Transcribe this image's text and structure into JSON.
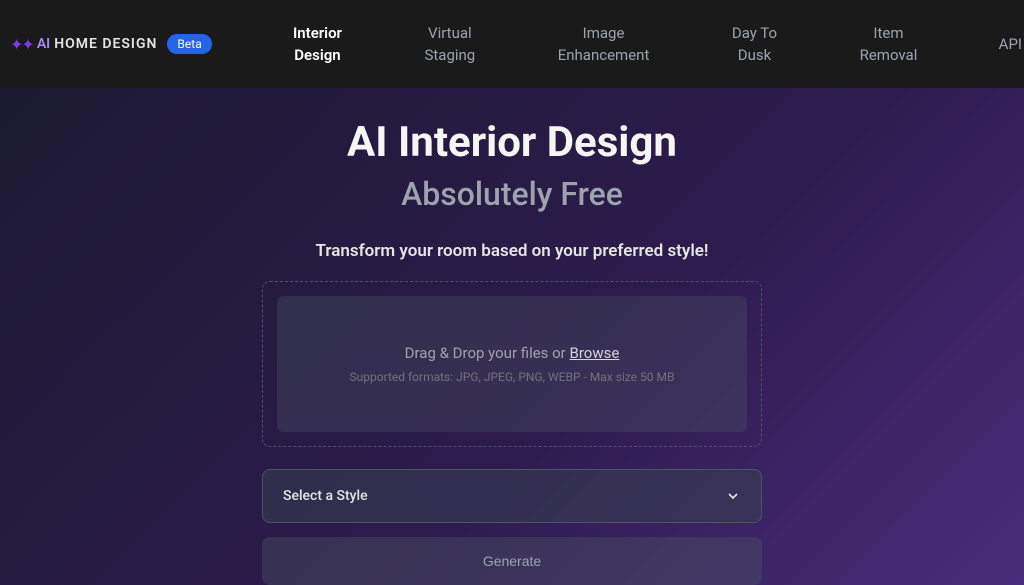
{
  "header": {
    "logo_ai": "AI",
    "logo_text": "HOME DESIGN",
    "beta_label": "Beta",
    "api_label": "API"
  },
  "nav": {
    "items": [
      {
        "label": "Interior\nDesign",
        "active": true
      },
      {
        "label": "Virtual\nStaging",
        "active": false
      },
      {
        "label": "Image\nEnhancement",
        "active": false
      },
      {
        "label": "Day To\nDusk",
        "active": false
      },
      {
        "label": "Item\nRemoval",
        "active": false
      }
    ]
  },
  "main": {
    "title": "AI Interior Design",
    "subtitle": "Absolutely Free",
    "description": "Transform your room based on your preferred style!",
    "upload": {
      "text_prefix": "Drag & Drop your files or ",
      "browse_label": "Browse",
      "hint": "Supported formats: JPG, JPEG, PNG, WEBP - Max size 50 MB"
    },
    "select": {
      "placeholder": "Select a Style"
    },
    "generate_label": "Generate"
  }
}
